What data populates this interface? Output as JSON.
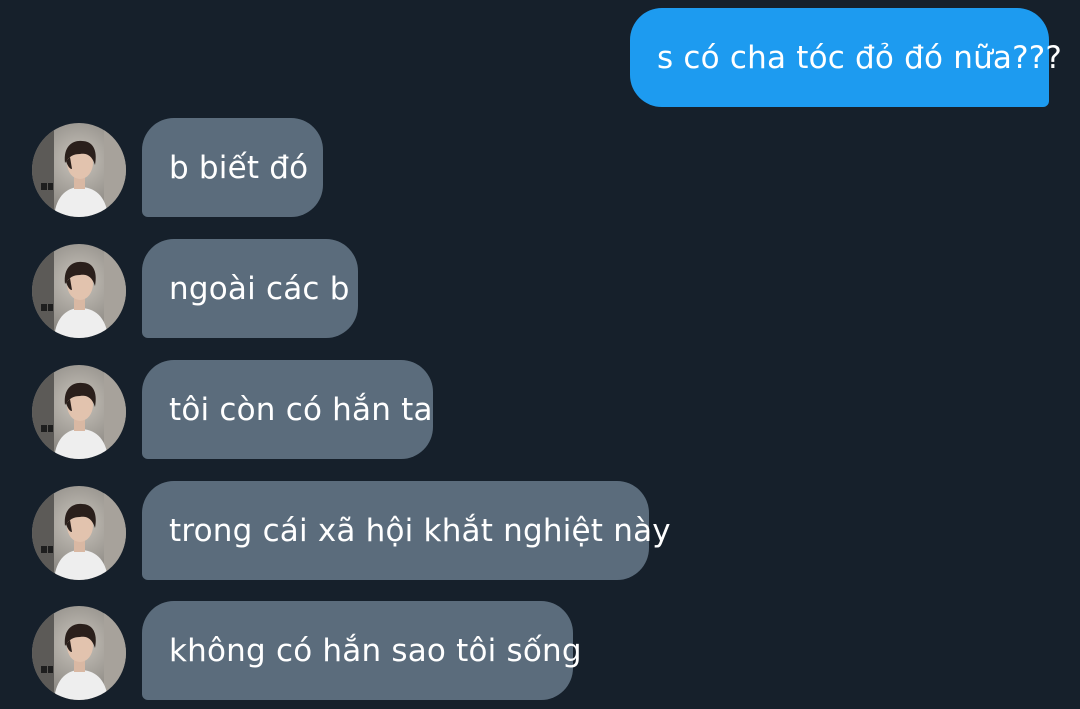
{
  "conversation": {
    "sent": [
      {
        "text": "s có cha tóc đỏ đó nữa???"
      }
    ],
    "received": [
      {
        "text": "b biết đó"
      },
      {
        "text": "ngoài các b"
      },
      {
        "text": "tôi còn có hắn ta"
      },
      {
        "text": "trong cái xã hội khắt nghiệt này"
      },
      {
        "text": "không có hắn sao tôi sống"
      }
    ]
  },
  "colors": {
    "background": "#16202b",
    "sent_bubble": "#1d9bf0",
    "received_bubble": "#5b6c7c",
    "text": "#ffffff"
  },
  "icons": {
    "avatar": "contact-avatar-photo"
  }
}
